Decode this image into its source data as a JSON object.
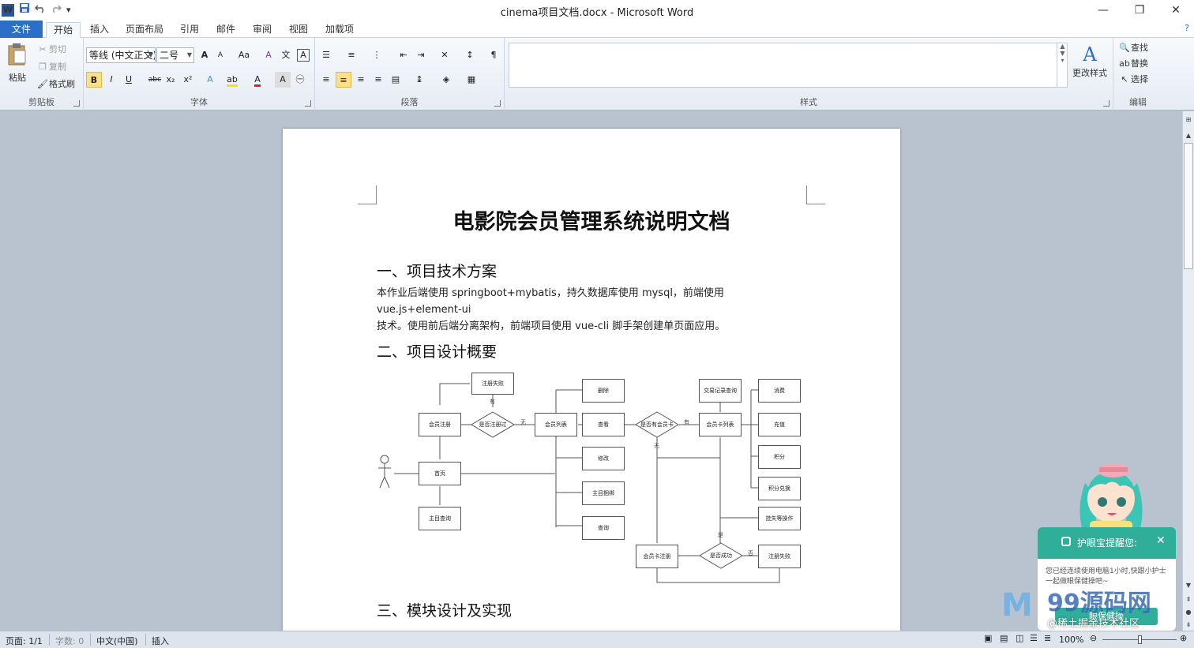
{
  "window": {
    "title": "cinema项目文档.docx - Microsoft Word",
    "app_icon": "W",
    "qat": {
      "save": "save-icon",
      "undo": "undo-icon",
      "redo": "redo-icon",
      "customize": "▾"
    },
    "controls": {
      "minimize": "—",
      "restore": "❐",
      "close": "✕"
    }
  },
  "tabs": {
    "file": "文件",
    "items": [
      "开始",
      "插入",
      "页面布局",
      "引用",
      "邮件",
      "审阅",
      "视图",
      "加载项"
    ],
    "active": "开始",
    "help": "?"
  },
  "ribbon": {
    "clipboard": {
      "label": "剪贴板",
      "paste": "粘贴",
      "cut": "剪切",
      "copy": "复制",
      "format_painter": "格式刷"
    },
    "font": {
      "label": "字体",
      "font_name": "等线 (中文正文)",
      "font_size": "二号",
      "grow": "A",
      "shrink": "A",
      "case": "Aa",
      "clear": "A",
      "bold": "B",
      "italic": "I",
      "underline": "U",
      "strike": "abc",
      "sub": "x₂",
      "sup": "x²",
      "font_color": "A",
      "char_shade": "A"
    },
    "paragraph": {
      "label": "段落"
    },
    "styles": {
      "label": "样式",
      "change_styles": "更改样式"
    },
    "editing": {
      "label": "编辑",
      "find": "查找",
      "replace": "替换",
      "select": "选择"
    }
  },
  "document": {
    "title": "电影院会员管理系统说明文档",
    "sections": [
      {
        "heading": "一、项目技术方案",
        "body_lines": [
          "本作业后端使用 springboot+mybatis，持久数据库使用 mysql，前端使用 vue.js+element-ui",
          "技术。使用前后端分离架构，前端项目使用 vue-cli 脚手架创建单页面应用。"
        ]
      },
      {
        "heading": "二、项目设计概要"
      },
      {
        "heading": "三、模块设计及实现"
      }
    ],
    "flowchart": {
      "register_fail_top": "注册失败",
      "register": "会员注册",
      "is_register_ok": "是否注册过",
      "no_label": "无",
      "yes_label": "有",
      "member_list": "会员列表",
      "delete": "删除",
      "view": "查看",
      "modify": "修改",
      "subject_bind": "主目捆绑",
      "query": "查询",
      "home": "首页",
      "subject_query": "主目查询",
      "has_card": "是否有会员卡",
      "card_list": "会员卡列表",
      "txn_query": "交易记录查询",
      "consume": "消费",
      "recharge": "充值",
      "points": "积分",
      "points_exchange": "积分兑换",
      "loss_ops": "挂失等操作",
      "card_register": "会员卡注册",
      "is_success": "是否成功",
      "yes2": "是",
      "no2": "否",
      "register_fail_bottom": "注册失败"
    }
  },
  "status": {
    "page": "页面: 1/1",
    "words": "字数: 0",
    "language": "中文(中国)",
    "mode": "插入",
    "zoom": "100%",
    "zoom_level": 1.0
  },
  "overlay": {
    "eyecare_title": "护眼宝提醒您:",
    "eyecare_text": "您已经连续使用电脑1小时,快跟小护士一起做眼保健操吧~",
    "eyecare_button": "眼保健操",
    "watermark_big": "99源码网",
    "watermark_small": "@稀土掘金技术社区"
  },
  "colors": {
    "accent": "#2b6fc8",
    "eyecare": "#2fae9a",
    "workspace": "#b9c3d0",
    "highlight": "#fbe08a"
  }
}
